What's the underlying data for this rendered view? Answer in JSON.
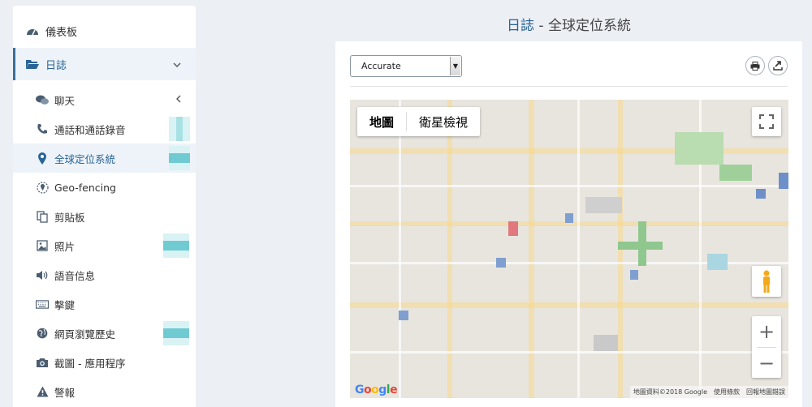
{
  "sidebar": {
    "dashboard": "儀表板",
    "logs": "日誌",
    "items": [
      {
        "label": "聊天",
        "icon": "chat-icon"
      },
      {
        "label": "通話和通話錄音",
        "icon": "phone-icon"
      },
      {
        "label": "全球定位系統",
        "icon": "location-pin-icon"
      },
      {
        "label": "Geo-fencing",
        "icon": "geofence-icon"
      },
      {
        "label": "剪貼板",
        "icon": "clipboard-icon"
      },
      {
        "label": "照片",
        "icon": "photo-icon"
      },
      {
        "label": "語音信息",
        "icon": "speaker-icon"
      },
      {
        "label": "擊鍵",
        "icon": "keyboard-icon"
      },
      {
        "label": "網頁瀏覽歷史",
        "icon": "globe-icon"
      },
      {
        "label": "截圖 - 應用程序",
        "icon": "camera-icon"
      },
      {
        "label": "警報",
        "icon": "warning-icon"
      }
    ]
  },
  "header": {
    "crumb": "日誌",
    "sep": " - ",
    "title": "全球定位系統"
  },
  "toolbar": {
    "accuracy_value": "Accurate"
  },
  "map": {
    "type_map": "地圖",
    "type_satellite": "衛星檢視",
    "zoom_in": "+",
    "zoom_out": "−",
    "logo": "Google",
    "attribution": "地圖資料©2018 Google",
    "terms": "使用條款",
    "report": "回報地圖錯誤"
  },
  "colors": {
    "accent": "#2a6496",
    "background": "#eceff4"
  }
}
